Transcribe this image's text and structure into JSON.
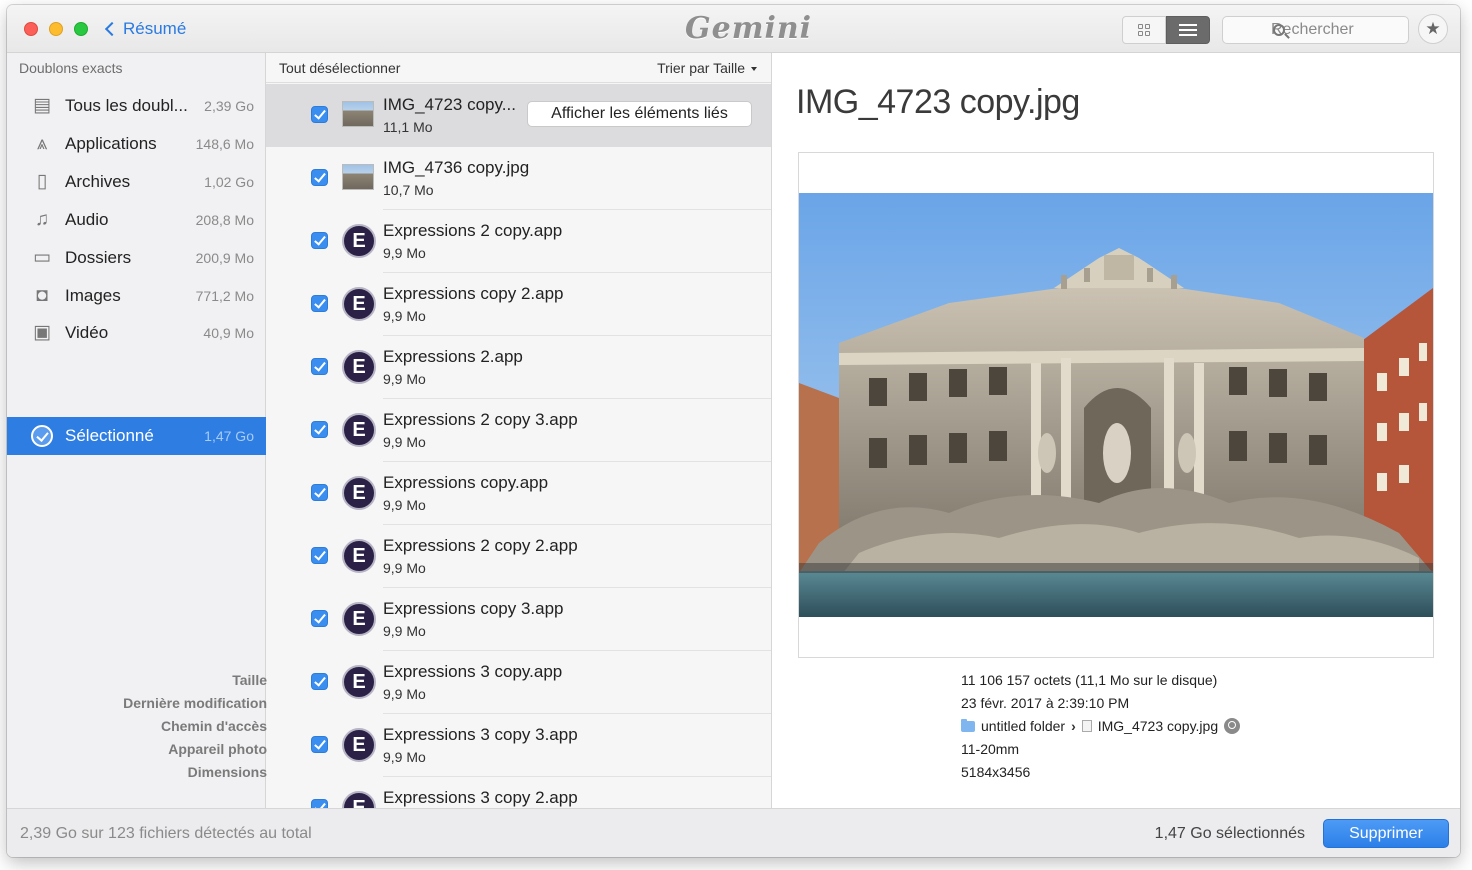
{
  "titlebar": {
    "back_label": "Résumé",
    "logo_text": "Gemini",
    "search_placeholder": "Rechercher"
  },
  "sidebar": {
    "heading": "Doublons exacts",
    "items": [
      {
        "label": "Tous les doubl...",
        "size": "2,39 Go",
        "icon": "stack-icon",
        "glyph": "▤"
      },
      {
        "label": "Applications",
        "size": "148,6 Mo",
        "icon": "app-store-icon",
        "glyph": "⩓"
      },
      {
        "label": "Archives",
        "size": "1,02 Go",
        "icon": "zip-file-icon",
        "glyph": "▯"
      },
      {
        "label": "Audio",
        "size": "208,8 Mo",
        "icon": "music-note-icon",
        "glyph": "♫"
      },
      {
        "label": "Dossiers",
        "size": "200,9 Mo",
        "icon": "folder-icon",
        "glyph": "▭"
      },
      {
        "label": "Images",
        "size": "771,2 Mo",
        "icon": "camera-icon",
        "glyph": "◘"
      },
      {
        "label": "Vidéo",
        "size": "40,9 Mo",
        "icon": "film-icon",
        "glyph": "▣"
      }
    ],
    "selected": {
      "label": "Sélectionné",
      "size": "1,47 Go"
    }
  },
  "list": {
    "deselect_all": "Tout désélectionner",
    "sort_label": "Trier par Taille",
    "linked_button": "Afficher les éléments liés",
    "rows": [
      {
        "name": "IMG_4723 copy...",
        "size": "11,1 Mo",
        "kind": "photo",
        "checked": true
      },
      {
        "name": "IMG_4736 copy.jpg",
        "size": "10,7 Mo",
        "kind": "photo",
        "checked": true
      },
      {
        "name": "Expressions 2 copy.app",
        "size": "9,9 Mo",
        "kind": "app",
        "checked": true
      },
      {
        "name": "Expressions copy 2.app",
        "size": "9,9 Mo",
        "kind": "app",
        "checked": true
      },
      {
        "name": "Expressions 2.app",
        "size": "9,9 Mo",
        "kind": "app",
        "checked": true
      },
      {
        "name": "Expressions 2 copy 3.app",
        "size": "9,9 Mo",
        "kind": "app",
        "checked": true
      },
      {
        "name": "Expressions copy.app",
        "size": "9,9 Mo",
        "kind": "app",
        "checked": true
      },
      {
        "name": "Expressions 2 copy 2.app",
        "size": "9,9 Mo",
        "kind": "app",
        "checked": true
      },
      {
        "name": "Expressions copy 3.app",
        "size": "9,9 Mo",
        "kind": "app",
        "checked": true
      },
      {
        "name": "Expressions 3 copy.app",
        "size": "9,9 Mo",
        "kind": "app",
        "checked": true
      },
      {
        "name": "Expressions 3 copy 3.app",
        "size": "9,9 Mo",
        "kind": "app",
        "checked": true
      },
      {
        "name": "Expressions 3 copy 2.app",
        "size": "",
        "kind": "app",
        "checked": true
      }
    ],
    "app_letter": "E"
  },
  "detail": {
    "title": "IMG_4723 copy.jpg",
    "info": {
      "size_key": "Taille",
      "size_val": "11 106 157 octets (11,1 Mo sur le disque)",
      "modified_key": "Dernière modification",
      "modified_val": "23 févr. 2017 à 2:39:10 PM",
      "path_key": "Chemin d'accès",
      "path_folder": "untitled folder",
      "path_sep": "›",
      "path_file": "IMG_4723 copy.jpg",
      "camera_key": "Appareil photo",
      "camera_val": "11-20mm",
      "dims_key": "Dimensions",
      "dims_val": "5184x3456"
    }
  },
  "footer": {
    "total": "2,39 Go sur 123 fichiers détectés au total",
    "selected": "1,47 Go sélectionnés",
    "delete_label": "Supprimer"
  },
  "colors": {
    "accent": "#2d7de3",
    "checkbox": "#3a8ef0",
    "app_icon_bg": "#2b2147"
  }
}
